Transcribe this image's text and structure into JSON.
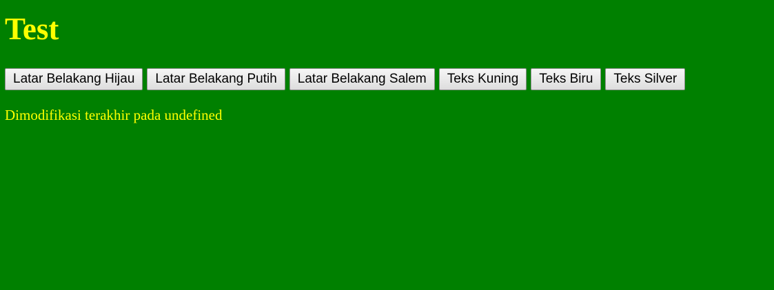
{
  "page": {
    "heading": "Test",
    "modified_text": "Dimodifikasi terakhir pada undefined"
  },
  "buttons": [
    {
      "label": "Latar Belakang Hijau"
    },
    {
      "label": "Latar Belakang Putih"
    },
    {
      "label": "Latar Belakang Salem"
    },
    {
      "label": "Teks Kuning"
    },
    {
      "label": "Teks Biru"
    },
    {
      "label": "Teks Silver"
    }
  ],
  "colors": {
    "background": "#008000",
    "text": "#ffff00"
  }
}
